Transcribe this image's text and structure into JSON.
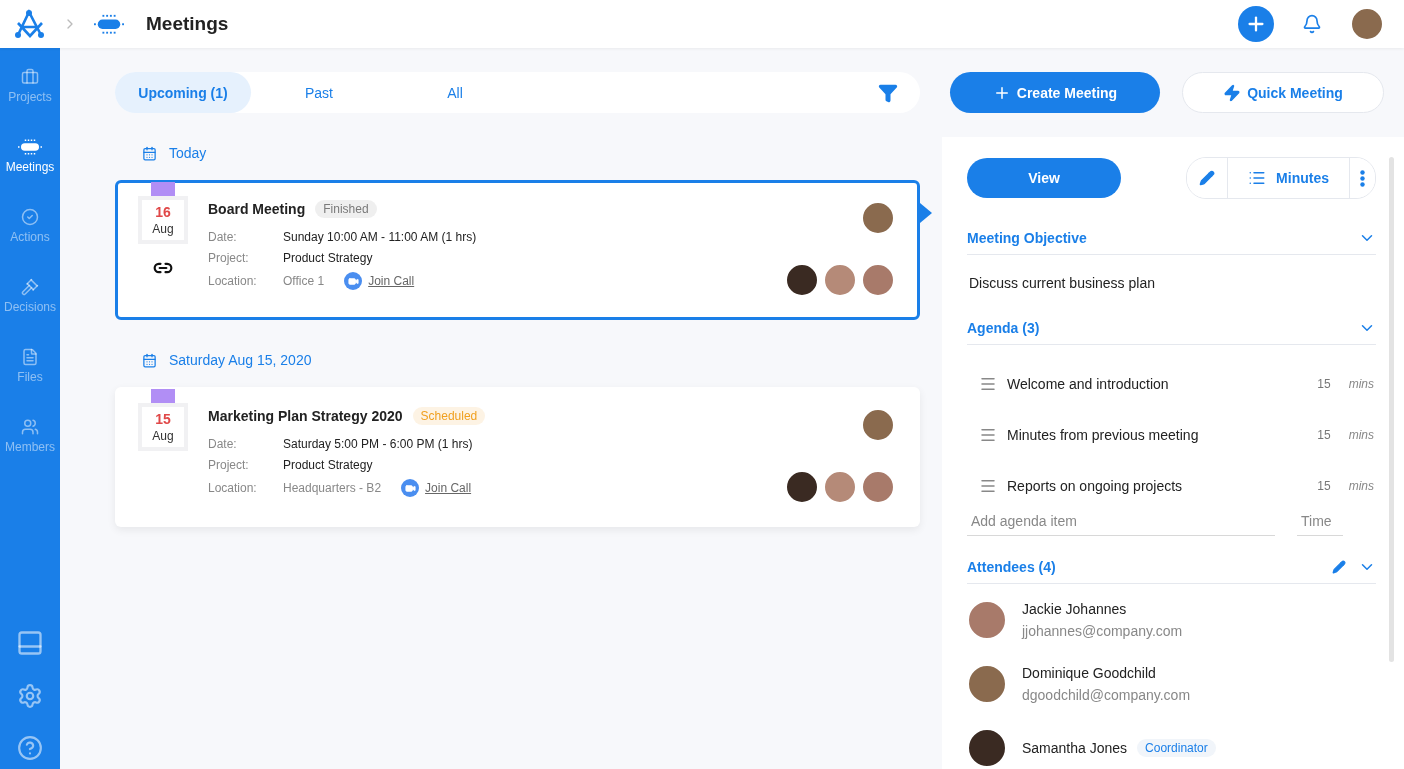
{
  "header": {
    "title": "Meetings"
  },
  "sidebar": {
    "items": [
      {
        "label": "Projects",
        "selected": false,
        "kind": "projects"
      },
      {
        "label": "Meetings",
        "selected": true,
        "kind": "meetings"
      },
      {
        "label": "Actions",
        "selected": false,
        "kind": "actions"
      },
      {
        "label": "Decisions",
        "selected": false,
        "kind": "decisions"
      },
      {
        "label": "Files",
        "selected": false,
        "kind": "files"
      },
      {
        "label": "Members",
        "selected": false,
        "kind": "members"
      }
    ]
  },
  "tabs": [
    {
      "label": "Upcoming (1)",
      "selected": true
    },
    {
      "label": "Past",
      "selected": false
    },
    {
      "label": "All",
      "selected": false
    }
  ],
  "actions": {
    "create": "Create Meeting",
    "quick": "Quick Meeting"
  },
  "groups": [
    {
      "heading": "Today",
      "meetings": [
        {
          "day": "16",
          "month": "Aug",
          "title": "Board Meeting",
          "status": {
            "label": "Finished",
            "color": "#7a7a7a"
          },
          "selected": true,
          "linked": true,
          "date_label": "Date:",
          "date": "Sunday 10:00 AM - 11:00 AM (1 hrs)",
          "project_label": "Project:",
          "project": "Product Strategy",
          "location_label": "Location:",
          "location": "Office 1",
          "call": "Join Call"
        }
      ]
    },
    {
      "heading": "Saturday Aug 15, 2020",
      "meetings": [
        {
          "day": "15",
          "month": "Aug",
          "title": "Marketing Plan Strategy 2020",
          "status": {
            "label": "Scheduled",
            "color": "#f0a020"
          },
          "selected": false,
          "linked": false,
          "date_label": "Date:",
          "date": "Saturday 5:00 PM - 6:00 PM (1 hrs)",
          "project_label": "Project:",
          "project": "Product Strategy",
          "location_label": "Location:",
          "location": "Headquarters - B2",
          "call": "Join Call"
        }
      ]
    }
  ],
  "panel": {
    "view": "View",
    "minutes": "Minutes",
    "objective": {
      "title": "Meeting Objective",
      "text": "Discuss current business plan"
    },
    "agenda": {
      "title": "Agenda (3)",
      "items": [
        {
          "title": "Welcome and introduction",
          "duration": "15",
          "unit": "mins"
        },
        {
          "title": "Minutes from previous meeting",
          "duration": "15",
          "unit": "mins"
        },
        {
          "title": "Reports on ongoing projects",
          "duration": "15",
          "unit": "mins"
        }
      ],
      "add_placeholder": "Add agenda item",
      "time_placeholder": "Time"
    },
    "attendees": {
      "title": "Attendees (4)",
      "people": [
        {
          "name": "Jackie Johannes",
          "email": "jjohannes@company.com"
        },
        {
          "name": "Dominique Goodchild",
          "email": "dgoodchild@company.com"
        },
        {
          "name": "Samantha Jones",
          "role": "Coordinator"
        }
      ]
    }
  }
}
